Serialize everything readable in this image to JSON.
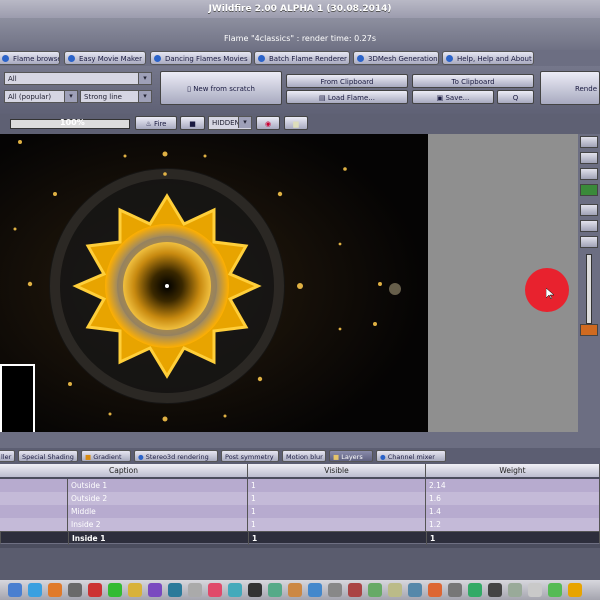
{
  "window": {
    "title": "JWildfire 2.00 ALPHA 1 (30.08.2014)"
  },
  "flame_title": "Flame \"4classics\" : render time: 0.27s",
  "tabs": [
    {
      "label": "Flame browser"
    },
    {
      "label": "Easy Movie Maker"
    },
    {
      "label": "Dancing Flames Movies"
    },
    {
      "label": "Batch Flame Renderer"
    },
    {
      "label": "3DMesh Generation"
    },
    {
      "label": "Help, Help and About"
    }
  ],
  "toolbar": {
    "select1_value": "All",
    "select2_value": "All (popular)",
    "select3_value": "Strong line",
    "new_from_scratch": "New from scratch",
    "from_clipboard": "From Clipboard",
    "to_clipboard": "To Clipboard",
    "load_flame": "Load Flame...",
    "save": "Save...",
    "q": "Q",
    "render": "Rende"
  },
  "zoom": {
    "value": "100%",
    "fire_label": "Fire",
    "mode_value": "HIDDEN"
  },
  "bottom_tabs": [
    {
      "label": "ller"
    },
    {
      "label": "Special Shading"
    },
    {
      "label": "Gradient"
    },
    {
      "label": "Stereo3d rendering"
    },
    {
      "label": "Post symmetry"
    },
    {
      "label": "Motion blur"
    },
    {
      "label": "Layers"
    },
    {
      "label": "Channel mixer"
    }
  ],
  "table": {
    "columns": [
      "Caption",
      "Visible",
      "Weight"
    ],
    "rows": [
      {
        "caption": "Outside 1",
        "visible": "1",
        "weight": "2.14"
      },
      {
        "caption": "Outside 2",
        "visible": "1",
        "weight": "1.6"
      },
      {
        "caption": "Middle",
        "visible": "1",
        "weight": "1.4"
      },
      {
        "caption": "Inside 2",
        "visible": "1",
        "weight": "1.2"
      },
      {
        "caption": "Inside 1",
        "visible": "1",
        "weight": "1"
      }
    ]
  },
  "colors": {
    "accent": "#e8222e",
    "fractal_gold": "#e8a400",
    "panel": "#6c6e82"
  }
}
